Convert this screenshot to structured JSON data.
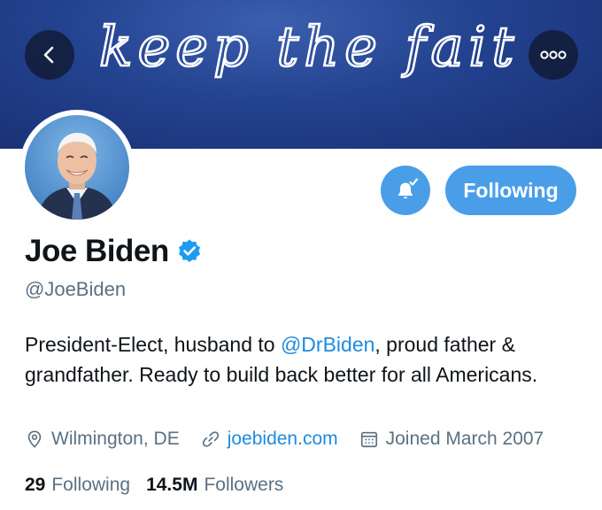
{
  "banner": {
    "handwriting": "keep the faith!"
  },
  "header": {
    "back_icon": "chevron-left-icon",
    "more_icon": "more-horizontal-icon"
  },
  "profile": {
    "display_name": "Joe Biden",
    "verified": true,
    "handle": "@JoeBiden",
    "bio": {
      "part1": "President-Elect, husband to ",
      "mention": "@DrBiden",
      "part2": ", proud father & grandfather. Ready to build back better for all Americans."
    },
    "location": "Wilmington, DE",
    "website": "joebiden.com",
    "joined": "Joined March 2007"
  },
  "actions": {
    "notifications_icon": "bell-check-icon",
    "following_label": "Following"
  },
  "stats": {
    "following_count": "29",
    "following_label": "Following",
    "followers_count": "14.5M",
    "followers_label": "Followers"
  },
  "colors": {
    "accent": "#4a9ee8",
    "link": "#1d8ae0",
    "banner": "#23428f",
    "muted": "#5b7083",
    "text": "#0f1419"
  }
}
